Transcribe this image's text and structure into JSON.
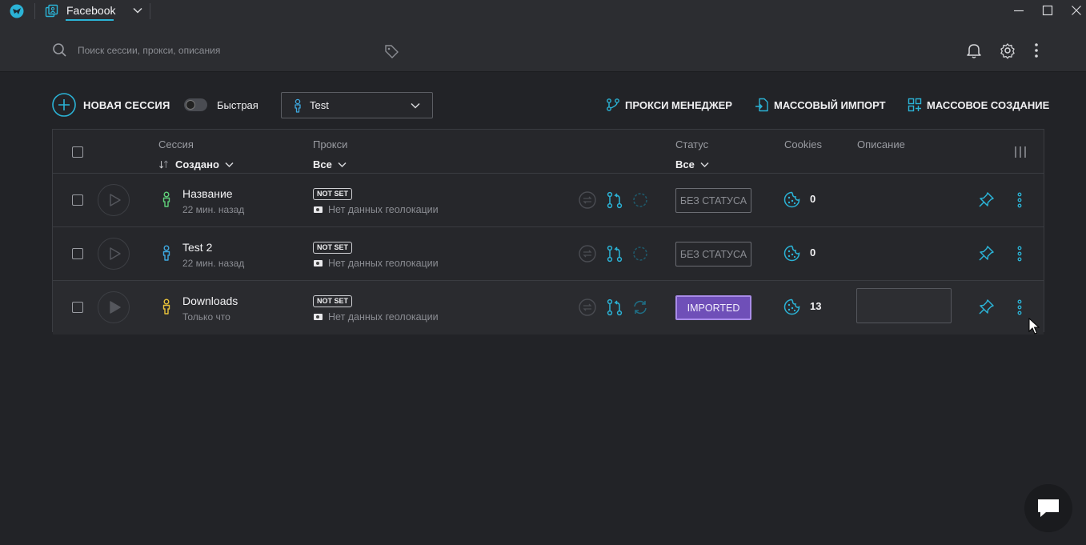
{
  "titlebar": {
    "profile_name": "Facebook"
  },
  "search": {
    "placeholder": "Поиск сессии, прокси, описания"
  },
  "actions": {
    "new_session": "НОВАЯ СЕССИЯ",
    "fast_label": "Быстрая",
    "profile_select_value": "Test",
    "proxy_manager": "ПРОКСИ МЕНЕДЖЕР",
    "mass_import": "МАССОВЫЙ ИМПОРТ",
    "mass_create": "МАССОВОЕ СОЗДАНИЕ"
  },
  "table": {
    "headers": {
      "session": "Сессия",
      "session_sort": "Создано",
      "proxy": "Прокси",
      "proxy_filter": "Все",
      "status": "Статус",
      "status_filter": "Все",
      "cookies": "Cookies",
      "description": "Описание"
    },
    "rows": [
      {
        "name": "Название",
        "created": "22 мин. назад",
        "proxy_badge": "NOT SET",
        "geo": "Нет данных геолокации",
        "status": "БЕЗ СТАТУСА",
        "cookies": "0",
        "person_color": "#5fd07a"
      },
      {
        "name": "Test 2",
        "created": "22 мин. назад",
        "proxy_badge": "NOT SET",
        "geo": "Нет данных геолокации",
        "status": "БЕЗ СТАТУСА",
        "cookies": "0",
        "person_color": "#3ea8e0"
      },
      {
        "name": "Downloads",
        "created": "Только что",
        "proxy_badge": "NOT SET",
        "geo": "Нет данных геолокации",
        "status": "IMPORTED",
        "cookies": "13",
        "person_color": "#e8c33a"
      }
    ]
  },
  "colors": {
    "accent": "#2bb3d6",
    "imported_status": "#6f4fb8",
    "background": "#222327"
  }
}
